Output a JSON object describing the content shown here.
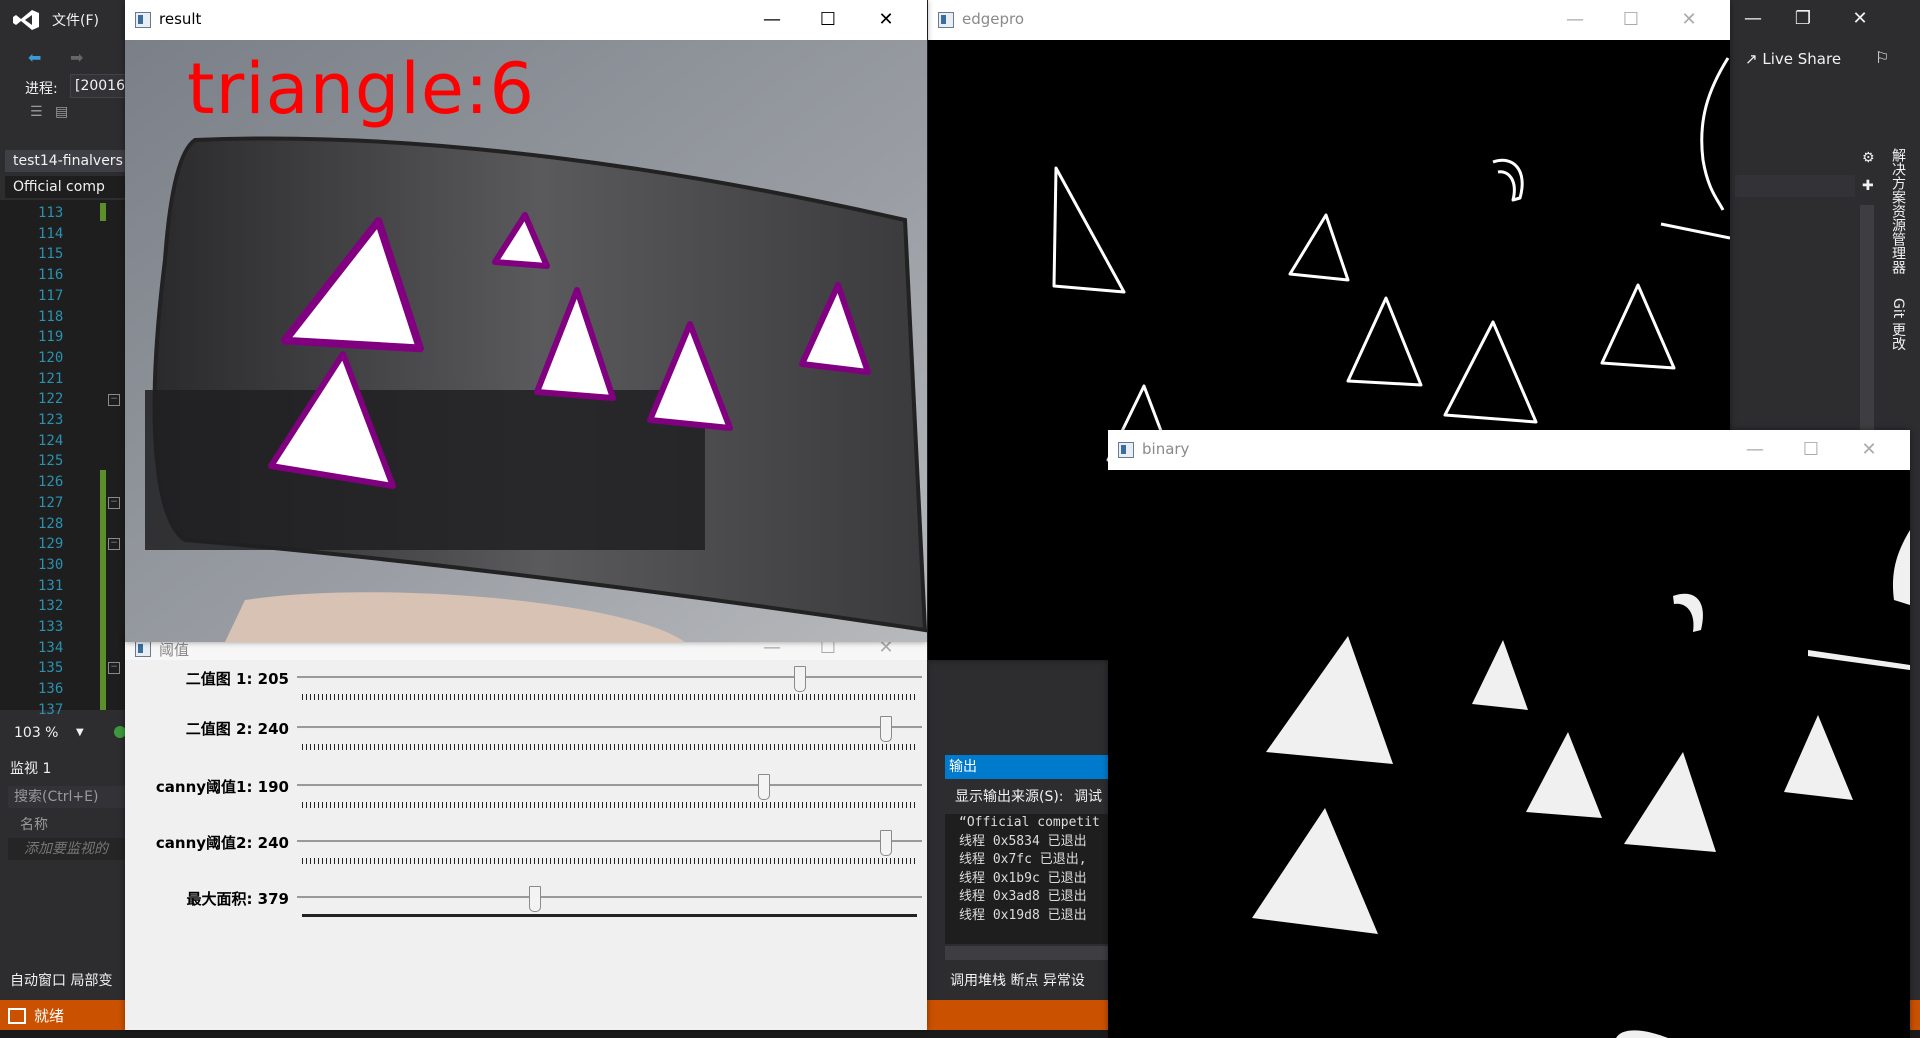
{
  "vs": {
    "menu_file": "文件(F)",
    "process_label": "进程:",
    "process_value": "[20016",
    "doc_tab": "test14-finalvers",
    "subtab": "Official comp",
    "line_numbers": [
      "113",
      "114",
      "115",
      "116",
      "117",
      "118",
      "119",
      "120",
      "121",
      "122",
      "123",
      "124",
      "125",
      "126",
      "127",
      "128",
      "129",
      "130",
      "131",
      "132",
      "133",
      "134",
      "135",
      "136",
      "137"
    ],
    "zoom": "103 %",
    "watch_title": "监视 1",
    "watch_search": "搜索(Ctrl+E)",
    "watch_name_col": "名称",
    "watch_add": "添加要监视的",
    "bottom_tabs": "自动窗口  局部变",
    "status": "就绪",
    "live_share": "Live Share",
    "side_tab_1": "解决方案资源管理器",
    "side_tab_2": "Git 更改",
    "output": {
      "title": "输出",
      "source_label": "显示输出来源(S):",
      "source_value": "调试",
      "lines": [
        "“Official competit",
        "线程 0x5834 已退出",
        "线程 0x7fc 已退出,",
        "线程 0x1b9c 已退出",
        "线程 0x3ad8 已退出",
        "线程 0x19d8 已退出"
      ],
      "tabs": "调用堆栈  断点  异常设"
    }
  },
  "windows": {
    "result": {
      "title": "result",
      "overlay_text": "triangle:6"
    },
    "edgepro": {
      "title": "edgepro"
    },
    "binary": {
      "title": "binary"
    },
    "threshold": {
      "title": "阈值",
      "rows": [
        {
          "label": "二值图 1: 205",
          "value": 205,
          "max": 255
        },
        {
          "label": "二值图 2: 240",
          "value": 240,
          "max": 255
        },
        {
          "label": "canny阈值1: 190",
          "value": 190,
          "max": 255
        },
        {
          "label": "canny阈值2: 240",
          "value": 240,
          "max": 255
        },
        {
          "label": "最大面积: 379",
          "value": 379,
          "max": 1000
        }
      ]
    }
  },
  "colors": {
    "vs_status": "#ca5100",
    "vs_accent": "#007acc",
    "overlay_red": "#ff0000",
    "triangle_outline": "#800080"
  }
}
